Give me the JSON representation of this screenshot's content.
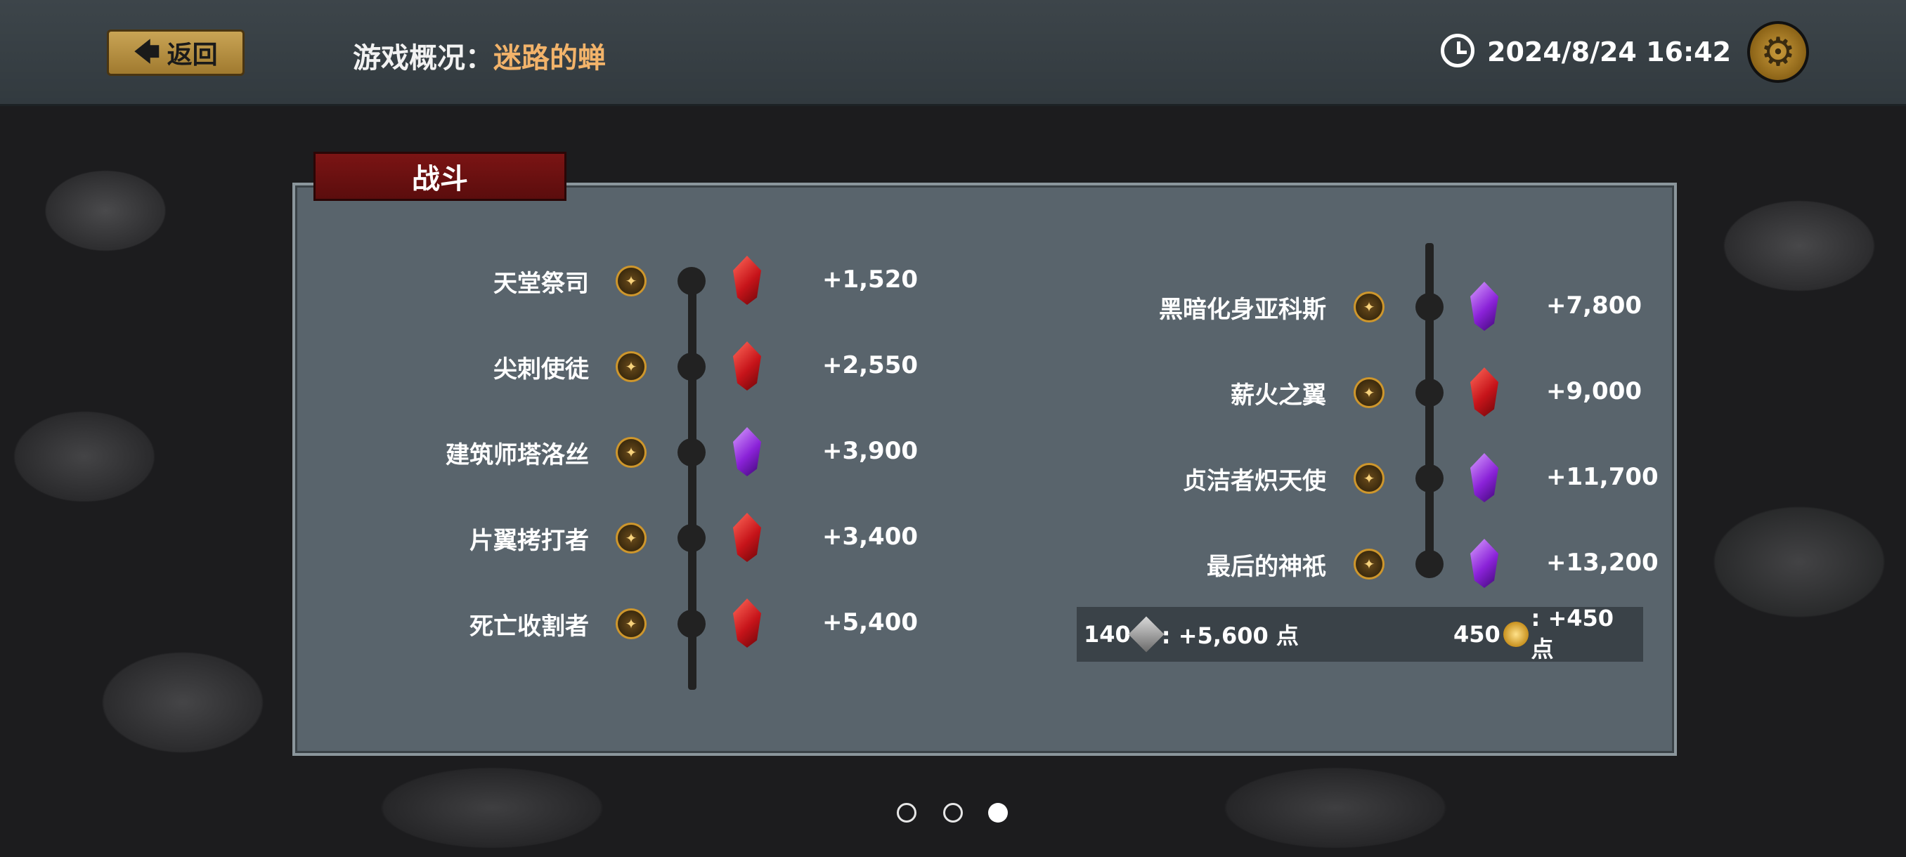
{
  "header": {
    "back_label": "返回",
    "title_prefix": "游戏概况：",
    "title_name": "迷路的蝉",
    "datetime": "2024/8/24 16:42"
  },
  "panel": {
    "tab_label": "战斗",
    "left_rows": [
      {
        "name": "天堂祭司",
        "gem": "red",
        "value": "+1,520"
      },
      {
        "name": "尖刺使徒",
        "gem": "red",
        "value": "+2,550"
      },
      {
        "name": "建筑师塔洛丝",
        "gem": "purple",
        "value": "+3,900"
      },
      {
        "name": "片翼拷打者",
        "gem": "red",
        "value": "+3,400"
      },
      {
        "name": "死亡收割者",
        "gem": "red",
        "value": "+5,400"
      }
    ],
    "right_rows": [
      {
        "name": "黑暗化身亚科斯",
        "gem": "purple",
        "value": "+7,800"
      },
      {
        "name": "薪火之翼",
        "gem": "red",
        "value": "+9,000"
      },
      {
        "name": "贞洁者炽天使",
        "gem": "purple",
        "value": "+11,700"
      },
      {
        "name": "最后的神祇",
        "gem": "purple",
        "value": "+13,200"
      }
    ],
    "summary": {
      "silver_count": "140",
      "silver_points": ": +5,600 点",
      "gold_count": "450",
      "gold_points": ": +450 点"
    }
  },
  "pager": {
    "total": 3,
    "active": 3
  },
  "colors": {
    "accent_title": "#f2b36a",
    "tab_red": "#7b1414",
    "gem_red": "#c7141a",
    "gem_purple": "#8a22d8"
  }
}
